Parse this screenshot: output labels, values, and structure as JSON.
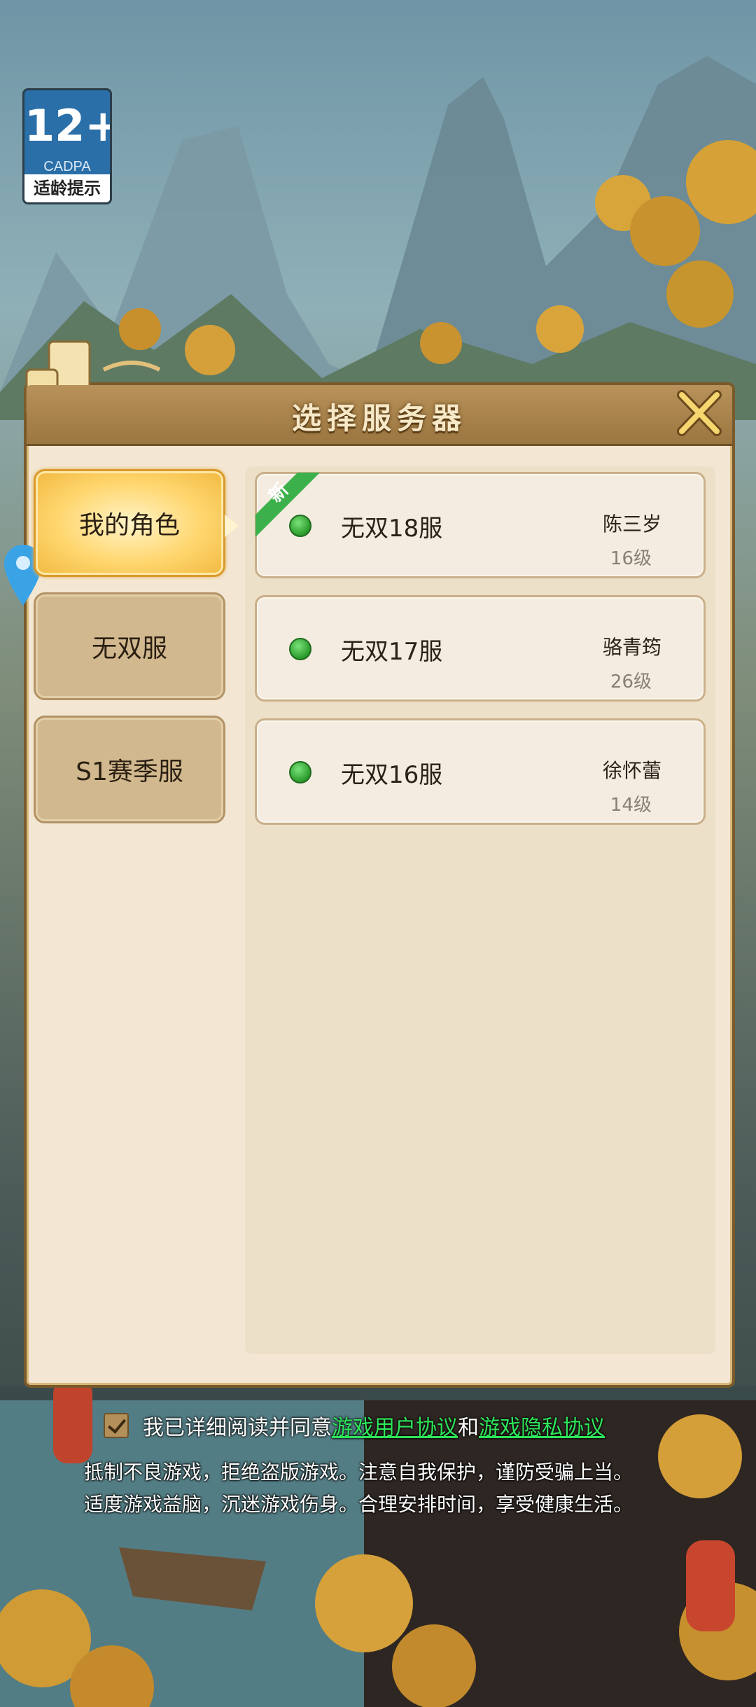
{
  "age_rating": {
    "number": "12+",
    "org": "CADPA",
    "tip": "适龄提示"
  },
  "dialog": {
    "title": "选择服务器"
  },
  "sidebar": {
    "items": [
      {
        "label": "我的角色",
        "active": true
      },
      {
        "label": "无双服",
        "active": false
      },
      {
        "label": "S1赛季服",
        "active": false
      }
    ]
  },
  "servers": [
    {
      "name": "无双18服",
      "player": "陈三岁",
      "level": "16级",
      "new_label": "新",
      "status_color": "#3fbf3f"
    },
    {
      "name": "无双17服",
      "player": "骆青筠",
      "level": "26级",
      "status_color": "#3fbf3f"
    },
    {
      "name": "无双16服",
      "player": "徐怀蕾",
      "level": "14级",
      "status_color": "#3fbf3f"
    }
  ],
  "agreement": {
    "prefix": "我已详细阅读并同意",
    "user_link": "游戏用户协议",
    "and": "和",
    "privacy_link": "游戏隐私协议",
    "checked": true
  },
  "notice": {
    "line1": "抵制不良游戏，拒绝盗版游戏。注意自我保护，谨防受骗上当。",
    "line2": "适度游戏益脑，沉迷游戏伤身。合理安排时间，享受健康生活。"
  }
}
